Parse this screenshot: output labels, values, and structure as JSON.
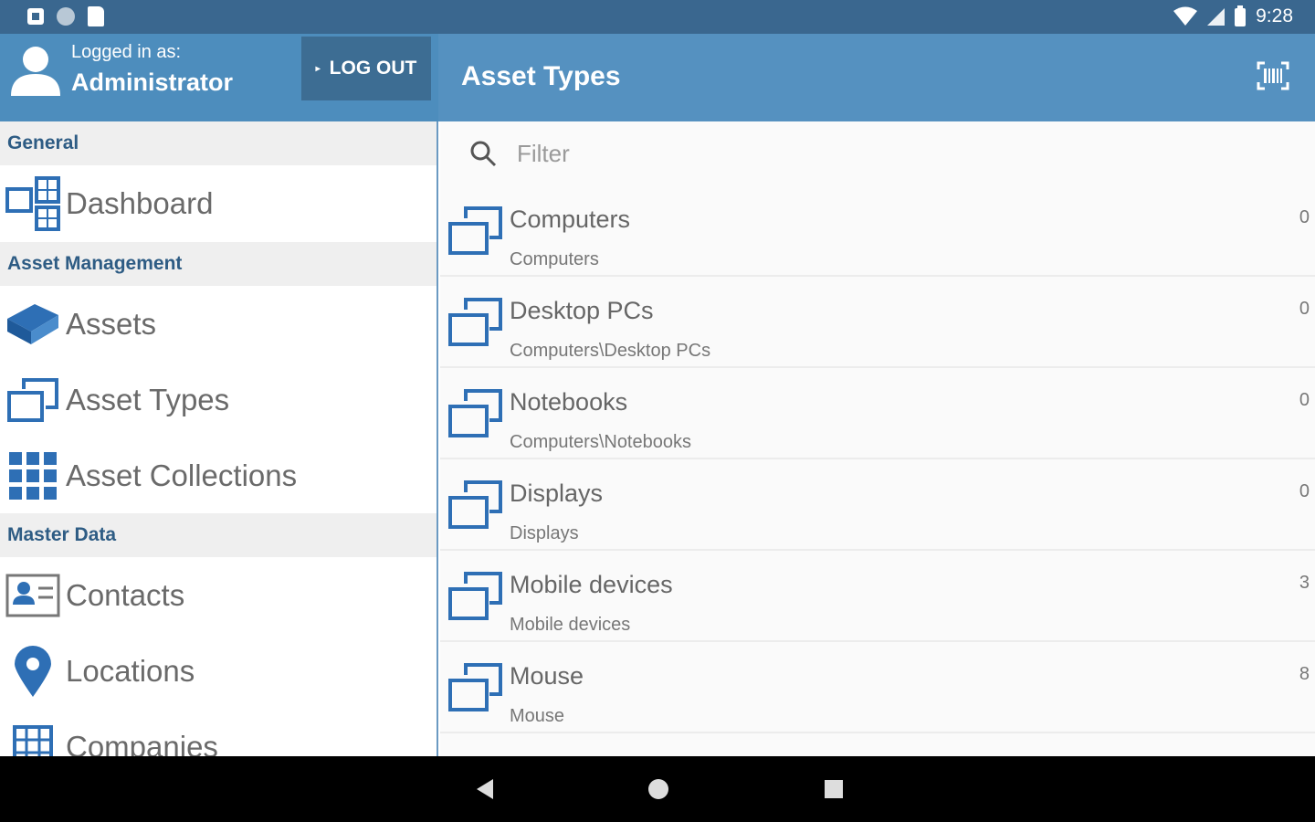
{
  "status_bar": {
    "time": "9:28"
  },
  "user": {
    "logged_in_label": "Logged in as:",
    "username": "Administrator",
    "logout_label": "LOG OUT"
  },
  "header": {
    "title": "Asset Types"
  },
  "sidebar": {
    "sections": [
      {
        "title": "General",
        "items": [
          {
            "label": "Dashboard",
            "icon": "dashboard-icon"
          }
        ]
      },
      {
        "title": "Asset Management",
        "items": [
          {
            "label": "Assets",
            "icon": "asset-box-icon"
          },
          {
            "label": "Asset Types",
            "icon": "asset-types-icon"
          },
          {
            "label": "Asset Collections",
            "icon": "grid-icon"
          }
        ]
      },
      {
        "title": "Master Data",
        "items": [
          {
            "label": "Contacts",
            "icon": "contact-card-icon"
          },
          {
            "label": "Locations",
            "icon": "location-pin-icon"
          },
          {
            "label": "Companies",
            "icon": "building-icon"
          }
        ]
      }
    ]
  },
  "filter": {
    "placeholder": "Filter"
  },
  "asset_types": [
    {
      "name": "Computers",
      "path": "Computers",
      "count": "0"
    },
    {
      "name": "Desktop PCs",
      "path": "Computers\\Desktop PCs",
      "count": "0"
    },
    {
      "name": "Notebooks",
      "path": "Computers\\Notebooks",
      "count": "0"
    },
    {
      "name": "Displays",
      "path": "Displays",
      "count": "0"
    },
    {
      "name": "Mobile devices",
      "path": "Mobile devices",
      "count": "3"
    },
    {
      "name": "Mouse",
      "path": "Mouse",
      "count": "8"
    }
  ],
  "colors": {
    "primary": "#5591c0",
    "accent": "#2e6fb5",
    "status_bar": "#3a678f"
  }
}
